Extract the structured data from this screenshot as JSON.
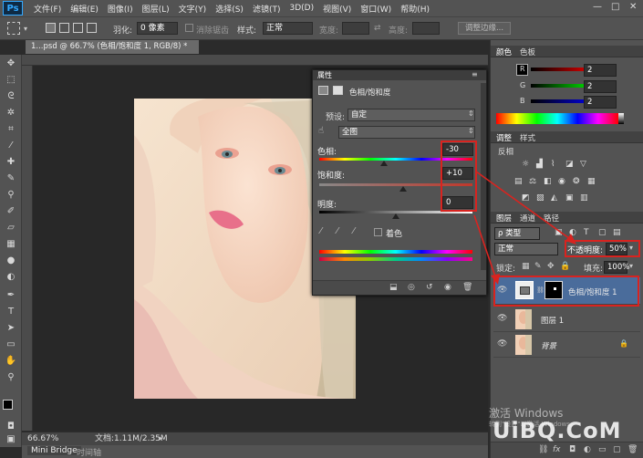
{
  "app": {
    "logo": "Ps"
  },
  "menu": [
    "文件(F)",
    "编辑(E)",
    "图像(I)",
    "图层(L)",
    "文字(Y)",
    "选择(S)",
    "滤镜(T)",
    "3D(D)",
    "视图(V)",
    "窗口(W)",
    "帮助(H)"
  ],
  "options_bar": {
    "feather_label": "羽化:",
    "feather_value": "0 像素",
    "antialias_label": "消除锯齿",
    "style_label": "样式:",
    "style_value": "正常",
    "width_label": "宽度:",
    "height_label": "高度:",
    "refine_button": "调整边缘..."
  },
  "document": {
    "tab_title": "1...psd @ 66.7% (色相/饱和度 1, RGB/8) *",
    "zoom": "66.67%",
    "doc_info": "文档:1.11M/2.35M"
  },
  "bottom_tabs": [
    "Mini Bridge",
    "时间轴"
  ],
  "properties": {
    "panel_title": "属性",
    "adjustment_name": "色相/饱和度",
    "preset_label": "预设:",
    "preset_value": "自定",
    "channel_value": "全图",
    "hue_label": "色相:",
    "hue_value": "-30",
    "saturation_label": "饱和度:",
    "saturation_value": "+10",
    "lightness_label": "明度:",
    "lightness_value": "0",
    "colorize_label": "着色",
    "hue_fraction": 0.42,
    "saturation_fraction": 0.55,
    "lightness_fraction": 0.5
  },
  "color_panel": {
    "tabs": [
      "颜色",
      "色板"
    ],
    "r_label": "R",
    "r_value": "2",
    "g_label": "G",
    "g_value": "2",
    "b_label": "B",
    "b_value": "2"
  },
  "adjust_panel": {
    "tabs": [
      "调整",
      "样式"
    ],
    "hint": "反相"
  },
  "layers_panel": {
    "tabs": [
      "图层",
      "通道",
      "路径"
    ],
    "filter_label": "ρ 类型",
    "blend_mode": "正常",
    "opacity_label": "不透明度:",
    "opacity_value": "50%",
    "lock_label": "锁定:",
    "fill_label": "填充:",
    "fill_value": "100%",
    "layers": [
      {
        "name": "色相/饱和度 1"
      },
      {
        "name": "图层 1"
      },
      {
        "name": "背景"
      }
    ]
  },
  "watermark": {
    "activate": "激活 Windows",
    "hint": "转到\"设置\"以激活 Windows。",
    "site": "UiBQ.CoM"
  },
  "colors": {
    "highlight": "#d9231f",
    "selected_layer": "#4a6c9b"
  }
}
